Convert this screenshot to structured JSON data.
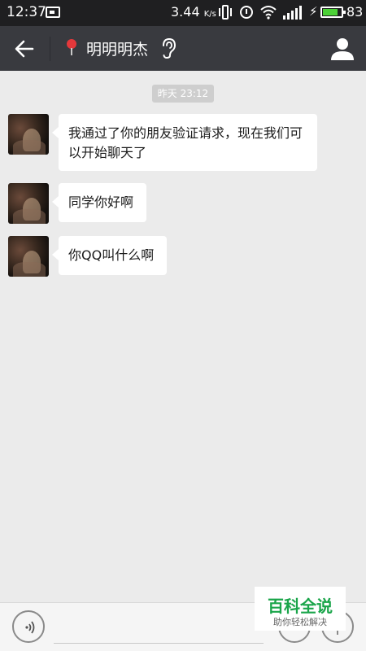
{
  "status_bar": {
    "time": "12:37",
    "speed_value": "3.44",
    "speed_unit": "K/s",
    "battery_percent": "83",
    "battery_level": 0.83,
    "icons": [
      "notification-icon",
      "vibrate-icon",
      "alarm-icon",
      "wifi-icon",
      "signal-icon",
      "charging-icon",
      "battery-icon"
    ]
  },
  "header": {
    "title": "明明明杰",
    "icons": [
      "back-arrow-icon",
      "location-pin-icon",
      "earpiece-icon",
      "person-icon"
    ],
    "pin_color": "#e5383b"
  },
  "chat": {
    "timestamp": "昨天 23:12",
    "messages": [
      {
        "sender": "other",
        "text": "我通过了你的朋友验证请求，现在我们可以开始聊天了"
      },
      {
        "sender": "other",
        "text": "同学你好啊"
      },
      {
        "sender": "other",
        "text": "你QQ叫什么啊"
      }
    ]
  },
  "input_bar": {
    "icons": [
      "voice-icon",
      "emoji-icon",
      "plus-icon"
    ],
    "value": ""
  },
  "watermark": {
    "title": "百科全说",
    "subtitle": "助你轻松解决",
    "color": "#1aa54a"
  }
}
